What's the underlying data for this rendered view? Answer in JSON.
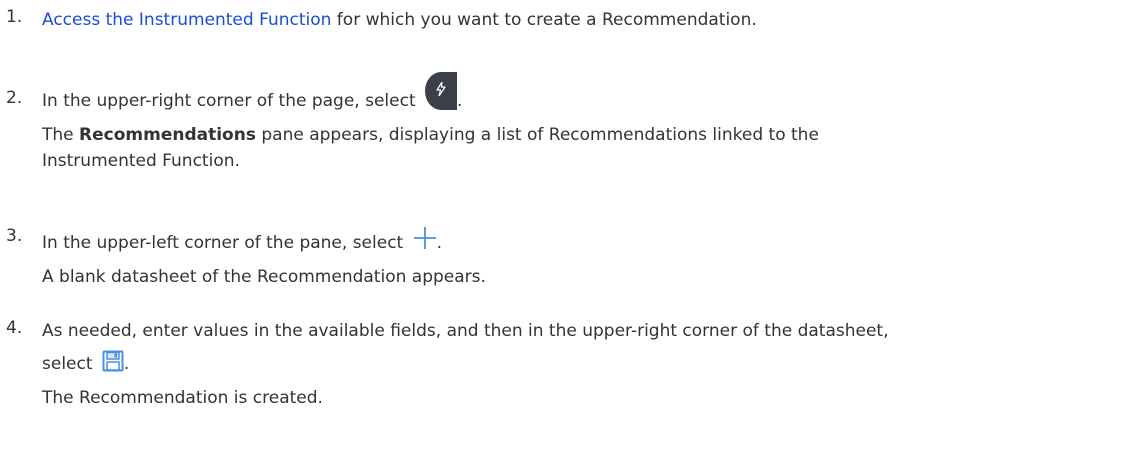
{
  "steps": [
    {
      "number": "1.",
      "link_text": "Access the Instrumented Function",
      "text_after": " for which you want to create a Recommendation."
    },
    {
      "number": "2.",
      "text_before": "In the upper-right corner of the page, select ",
      "text_after": ".",
      "icon": "recommendations-icon",
      "result_bold": "Recommendations",
      "result_line1_rest": " pane appears, displaying a list of Recommendations linked to the",
      "result_line1_prefix": "The ",
      "result_line2": "Instrumented Function."
    },
    {
      "number": "3.",
      "text_before": "In the upper-left corner of the pane, select ",
      "text_after": ".",
      "icon": "plus-icon",
      "result": "A blank datasheet of the Recommendation appears."
    },
    {
      "number": "4.",
      "line1": "As needed, enter values in the available fields, and then in the upper-right corner of the datasheet,",
      "line2_before": "select ",
      "line2_after": ".",
      "icon": "save-icon",
      "result": "The Recommendation is created."
    }
  ],
  "colors": {
    "text": "#333333",
    "link": "#1a4dd6",
    "icon_dark": "#3a3f48",
    "icon_blue": "#4a90d9"
  }
}
